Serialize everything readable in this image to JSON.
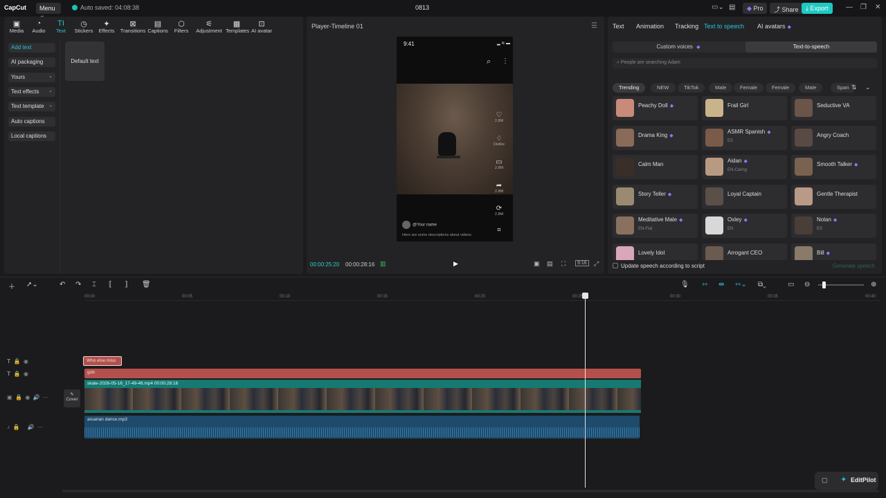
{
  "titlebar": {
    "logo": "CapCut",
    "menu": "Menu",
    "autosave": "Auto saved: 04:08:38",
    "project": "0813",
    "pro": "Pro",
    "share": "Share",
    "export": "Export"
  },
  "toolbar": [
    "Media",
    "Audio",
    "Text",
    "Stickers",
    "Effects",
    "Transitions",
    "Captions",
    "Filters",
    "Adjustment",
    "Templates",
    "AI avatar"
  ],
  "toolbar_icons": [
    "media-icon",
    "audio-icon",
    "text-icon",
    "stickers-icon",
    "effects-icon",
    "transitions-icon",
    "captions-icon",
    "filters-icon",
    "adjustment-icon",
    "templates-icon",
    "ai-avatar-icon"
  ],
  "text_sidebar": [
    "Add text",
    "AI packaging",
    "Yours",
    "Text effects",
    "Text template",
    "Auto captions",
    "Local captions"
  ],
  "default_text_card": "Default text",
  "player": {
    "title": "Player-Timeline 01",
    "phone_time": "9:41",
    "like_count": "2.8M",
    "dislike": "Dislike",
    "comment_count": "2.8M",
    "share_count": "2.8M",
    "remix_count": "2.8M",
    "username": "@Your name",
    "description": "Here are some descriptions about videos",
    "current_time": "00:00:25:20",
    "total_time": "00:00:28:16",
    "ratio": "9:16"
  },
  "right_panel": {
    "tabs": [
      "Text",
      "Animation",
      "Tracking",
      "Text to speech",
      "AI avatars"
    ],
    "active_tab": "Text to speech",
    "segments": [
      "Custom voices",
      "Text-to-speech"
    ],
    "search_placeholder": "People are searching Adam",
    "chips": [
      "Trending",
      "NEW",
      "TikTok",
      "Male",
      "Female",
      "Female",
      "Male",
      "Span"
    ],
    "voices": [
      {
        "name": "Peachy Doll",
        "sub": "",
        "color": "#c98a7a"
      },
      {
        "name": "Frail Girl",
        "sub": "",
        "color": "#c9b48a"
      },
      {
        "name": "Seductive VA",
        "sub": "",
        "color": "#6b5448"
      },
      {
        "name": "Drama King",
        "sub": "",
        "color": "#8a6a58"
      },
      {
        "name": "ASMR Spanish",
        "sub": "ES",
        "color": "#7a5a48"
      },
      {
        "name": "Angry Coach",
        "sub": "",
        "color": "#5a4a44"
      },
      {
        "name": "Calm Man",
        "sub": "",
        "color": "#3a2e28"
      },
      {
        "name": "Aidan",
        "sub": "EN-Caring",
        "color": "#b89a82"
      },
      {
        "name": "Smooth Talker",
        "sub": "",
        "color": "#7a6250"
      },
      {
        "name": "Story Teller",
        "sub": "",
        "color": "#9a8a72"
      },
      {
        "name": "Loyal Captain",
        "sub": "",
        "color": "#5a5048"
      },
      {
        "name": "Gentle Therapist",
        "sub": "",
        "color": "#b89a86"
      },
      {
        "name": "Meditative Male",
        "sub": "EN-Flat",
        "color": "#8a705e"
      },
      {
        "name": "Oxley",
        "sub": "EN",
        "color": "#d8d8d8"
      },
      {
        "name": "Nolan",
        "sub": "ES",
        "color": "#4a3e38"
      },
      {
        "name": "Lovely Idol",
        "sub": "",
        "color": "#d8a8b8"
      },
      {
        "name": "Arrogant CEO",
        "sub": "",
        "color": "#6a5a50"
      },
      {
        "name": "Bill",
        "sub": "",
        "color": "#8a7a6a"
      }
    ],
    "update_label": "Update speech according to script",
    "generate": "Generate speech"
  },
  "timeline": {
    "ruler": [
      "00:00",
      "00:05",
      "00:10",
      "00:15",
      "00:20",
      "00:25",
      "00:30",
      "00:35",
      "00:40"
    ],
    "text_clip_1": "Who else miss",
    "text_clip_2": "gob",
    "video_clip": "skate-2026-05-16_17-49-46.mp4  00:00:28:16",
    "cover": "Cover",
    "audio_clip": "aruarian dance.mp3"
  },
  "editpilot": "EditPilot",
  "colors": {
    "accent": "#27c4d6",
    "export": "#1fc9c1",
    "text_clip": "#b4504c",
    "video_clip": "#177a72",
    "audio_clip": "#1e4b6b"
  }
}
